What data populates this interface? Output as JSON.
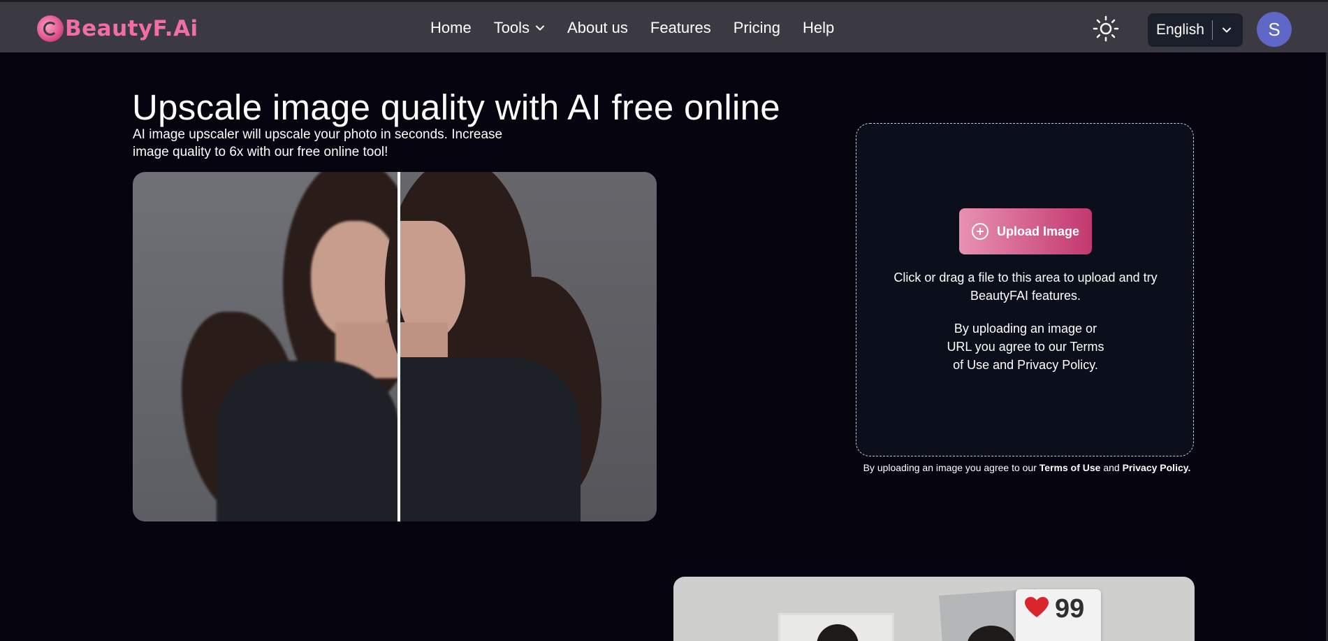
{
  "brand": {
    "name": "BeautyF.Ai",
    "accent": "#f06ea4"
  },
  "nav": {
    "items": [
      {
        "label": "Home"
      },
      {
        "label": "Tools",
        "has_dropdown": true
      },
      {
        "label": "About us"
      },
      {
        "label": "Features"
      },
      {
        "label": "Pricing"
      },
      {
        "label": "Help"
      }
    ]
  },
  "header": {
    "theme_icon": "sun-icon",
    "language": "English",
    "avatar_initial": "S",
    "avatar_color": "#5f67c7",
    "background": "#3b3a42"
  },
  "hero": {
    "title": "Upscale image quality with AI free online",
    "subtitle": "AI image upscaler will upscale your photo in seconds. Increase image quality to 6x with our free online tool!"
  },
  "upload": {
    "button_label": "Upload Image",
    "button_icon": "plus-circle-icon",
    "hint": "Click or drag a file to this area to upload and try BeautyFAI features.",
    "terms_line": "By uploading an image or URL you agree to our Terms of Use and Privacy Policy."
  },
  "terms_note": {
    "prefix": "By uploading an image you agree to our",
    "terms_link": "Terms of Use",
    "conjunction": "and",
    "privacy_link": "Privacy Policy."
  },
  "preview": {
    "like_count": "99",
    "like_icon": "heart-icon"
  },
  "colors": {
    "page_background": "#05040f",
    "upload_box_background": "#0b0e1b",
    "upload_button_start": "#e891b2",
    "upload_button_end": "#c2386f"
  }
}
